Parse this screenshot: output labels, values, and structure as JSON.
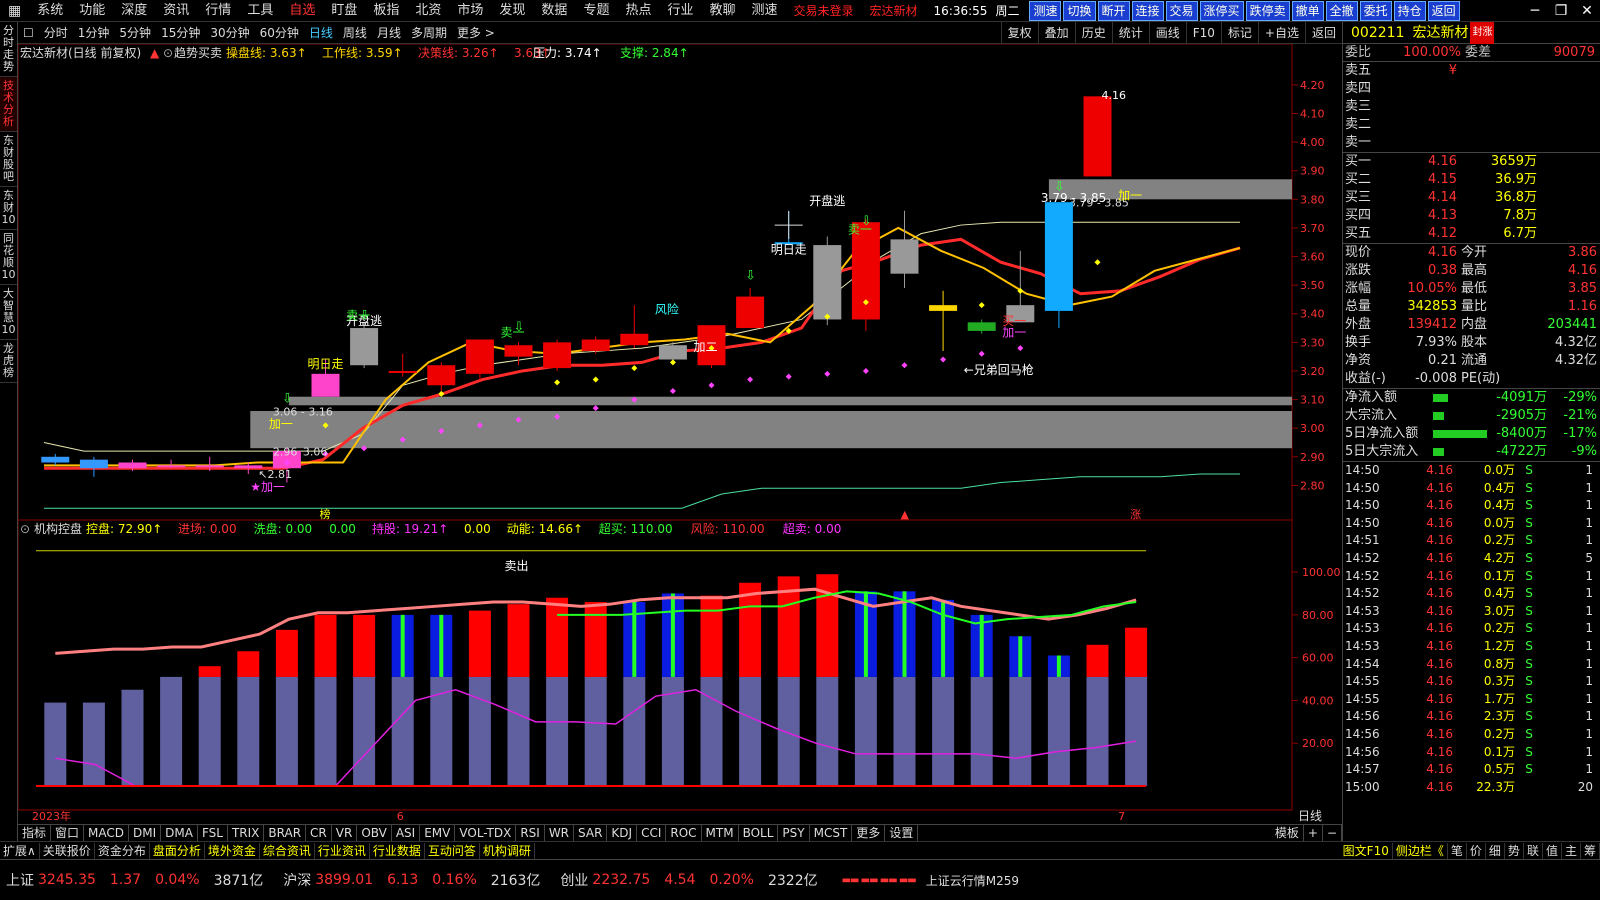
{
  "menubar": {
    "items": [
      "系统",
      "功能",
      "深度",
      "资讯",
      "行情",
      "工具",
      "自选",
      "盯盘",
      "板指",
      "北资",
      "市场",
      "发现",
      "数据",
      "专题",
      "热点",
      "行业",
      "教聊",
      "测速"
    ],
    "active_index": 6,
    "warning1": "交易未登录",
    "warning2": "宏达新材",
    "clock": "16:36:55",
    "weekday": "周二",
    "quick_buttons": [
      "测速",
      "切换",
      "断开",
      "连接",
      "交易",
      "涨停买",
      "跌停卖",
      "撤单",
      "全撤",
      "委托",
      "持仓",
      "返回"
    ],
    "window_controls": [
      "─",
      "❐",
      "✕"
    ]
  },
  "leftbar": {
    "tabs": [
      "分时走势",
      "技术分析",
      "东财股吧",
      "东财10",
      "同花顺10",
      "大智慧10",
      "龙虎榜"
    ],
    "active_index": 1
  },
  "periodbar": {
    "items": [
      "分时",
      "1分钟",
      "5分钟",
      "15分钟",
      "30分钟",
      "60分钟",
      "日线",
      "周线",
      "月线",
      "多周期",
      "更多 >"
    ],
    "active_index": 6,
    "tools": [
      "复权",
      "叠加",
      "历史",
      "统计",
      "画线",
      "F10",
      "标记",
      "+自选",
      "返回"
    ]
  },
  "main_chart": {
    "title": "宏达新材(日线 前复权)",
    "indicator_name": "趋势买卖",
    "labels": [
      {
        "name": "操盘线",
        "value": "3.63↑",
        "color": "#ffd700"
      },
      {
        "name": "工作线",
        "value": "3.59↑",
        "color": "#ffd700"
      },
      {
        "name": "决策线",
        "value": "3.26↑",
        "color": "#ff3333"
      },
      {
        "name": "",
        "value": "3.63↑",
        "color": "#ff3333"
      },
      {
        "name": "压力",
        "value": "3.74↑",
        "color": "#ffffff"
      },
      {
        "name": "支撑",
        "value": "2.84↑",
        "color": "#33ff33"
      }
    ],
    "annotations": [
      "明日走",
      "开盘逃",
      "明日走",
      "开盘逃",
      "卖一",
      "卖一",
      "风险",
      "加二",
      "加一",
      "加一",
      "←兄弟回马枪",
      "3.06 - 3.16",
      "2.96",
      "3.06",
      "2.81",
      "3.79 - 3.85",
      "4.16",
      "加一",
      "买一",
      "卖一"
    ],
    "bottom_markers": [
      "榜",
      "▲",
      "涨"
    ],
    "date_labels": [
      "2023年",
      "6",
      "7"
    ]
  },
  "sub_chart": {
    "name": "机构控盘",
    "labels": [
      {
        "name": "控盘",
        "value": "72.90↑",
        "color": "#ffff00"
      },
      {
        "name": "进场",
        "value": "0.00",
        "color": "#ff3333"
      },
      {
        "name": "洗盘",
        "value": "0.00",
        "color": "#33ff33"
      },
      {
        "name": "",
        "value": "0.00",
        "color": "#33ff33"
      },
      {
        "name": "持股",
        "value": "19.21↑",
        "color": "#ff33ff"
      },
      {
        "name": "",
        "value": "0.00",
        "color": "#ffff00"
      },
      {
        "name": "动能",
        "value": "14.66↑",
        "color": "#ffff00"
      },
      {
        "name": "超买",
        "value": "110.00",
        "color": "#33ff33"
      },
      {
        "name": "风险",
        "value": "110.00",
        "color": "#ff3333"
      },
      {
        "name": "超卖",
        "value": "0.00",
        "color": "#ff33ff"
      }
    ],
    "annotation": "卖出",
    "period_label": "日线"
  },
  "chart_data": [
    {
      "type": "candlestick",
      "title": "宏达新材(日线 前复权)",
      "ylim": [
        2.7,
        4.28
      ],
      "y_ticks": [
        4.2,
        4.1,
        4.0,
        3.9,
        3.8,
        3.7,
        3.6,
        3.5,
        3.4,
        3.3,
        3.2,
        3.1,
        3.0,
        2.9,
        2.8
      ],
      "candles": [
        {
          "o": 2.9,
          "c": 2.88,
          "h": 2.91,
          "l": 2.87
        },
        {
          "o": 2.89,
          "c": 2.86,
          "h": 2.9,
          "l": 2.83
        },
        {
          "o": 2.86,
          "c": 2.88,
          "h": 2.89,
          "l": 2.85
        },
        {
          "o": 2.87,
          "c": 2.87,
          "h": 2.89,
          "l": 2.86
        },
        {
          "o": 2.87,
          "c": 2.87,
          "h": 2.9,
          "l": 2.85
        },
        {
          "o": 2.86,
          "c": 2.87,
          "h": 2.88,
          "l": 2.84
        },
        {
          "o": 2.86,
          "c": 2.92,
          "h": 2.93,
          "l": 2.81
        },
        {
          "o": 3.11,
          "c": 3.19,
          "h": 3.24,
          "l": 3.11
        },
        {
          "o": 3.35,
          "c": 3.22,
          "h": 3.37,
          "l": 3.21
        },
        {
          "o": 3.2,
          "c": 3.2,
          "h": 3.26,
          "l": 3.18
        },
        {
          "o": 3.15,
          "c": 3.22,
          "h": 3.23,
          "l": 3.13
        },
        {
          "o": 3.19,
          "c": 3.31,
          "h": 3.31,
          "l": 3.17
        },
        {
          "o": 3.25,
          "c": 3.29,
          "h": 3.3,
          "l": 3.22
        },
        {
          "o": 3.21,
          "c": 3.3,
          "h": 3.31,
          "l": 3.2
        },
        {
          "o": 3.27,
          "c": 3.31,
          "h": 3.32,
          "l": 3.26
        },
        {
          "o": 3.29,
          "c": 3.33,
          "h": 3.43,
          "l": 3.28
        },
        {
          "o": 3.29,
          "c": 3.24,
          "h": 3.3,
          "l": 3.23
        },
        {
          "o": 3.22,
          "c": 3.36,
          "h": 3.36,
          "l": 3.21
        },
        {
          "o": 3.35,
          "c": 3.46,
          "h": 3.49,
          "l": 3.35
        },
        {
          "o": 3.65,
          "c": 3.65,
          "h": 3.76,
          "l": 3.64
        },
        {
          "o": 3.64,
          "c": 3.38,
          "h": 3.67,
          "l": 3.36
        },
        {
          "o": 3.38,
          "c": 3.72,
          "h": 3.73,
          "l": 3.34
        },
        {
          "o": 3.66,
          "c": 3.54,
          "h": 3.76,
          "l": 3.49
        },
        {
          "o": 3.43,
          "c": 3.41,
          "h": 3.48,
          "l": 3.27
        },
        {
          "o": 3.37,
          "c": 3.34,
          "h": 3.38,
          "l": 3.33
        },
        {
          "o": 3.43,
          "c": 3.37,
          "h": 3.62,
          "l": 3.37
        },
        {
          "o": 3.41,
          "c": 3.79,
          "h": 3.79,
          "l": 3.35
        },
        {
          "o": 3.88,
          "c": 4.16,
          "h": 4.16,
          "l": 3.88
        }
      ],
      "lines": {
        "decision_line": [
          2.86,
          2.86,
          2.86,
          2.86,
          2.86,
          2.86,
          2.86,
          2.89,
          3.0,
          3.08,
          3.12,
          3.17,
          3.2,
          3.22,
          3.22,
          3.23,
          3.27,
          3.28,
          3.3,
          3.35,
          3.55,
          3.59,
          3.64,
          3.66,
          3.58,
          3.54,
          3.47,
          3.48,
          3.53,
          3.59,
          3.63
        ],
        "work_line": [
          2.87,
          2.87,
          2.87,
          2.87,
          2.87,
          2.88,
          2.88,
          2.88,
          3.1,
          3.23,
          3.3,
          3.27,
          3.26,
          3.28,
          3.3,
          3.31,
          3.33,
          3.3,
          3.43,
          3.62,
          3.7,
          3.62,
          3.56,
          3.47,
          3.43,
          3.46,
          3.55,
          3.59,
          3.63
        ],
        "pressure_line": [
          2.95,
          2.92,
          2.92,
          2.92,
          2.92,
          2.92,
          2.92,
          2.92,
          2.98,
          3.15,
          3.19,
          3.22,
          3.24,
          3.26,
          3.27,
          3.28,
          3.3,
          3.32,
          3.35,
          3.38,
          3.49,
          3.6,
          3.68,
          3.71,
          3.72,
          3.72,
          3.72,
          3.72,
          3.72,
          3.72,
          3.72
        ],
        "support_line": [
          2.72,
          2.72,
          2.72,
          2.72,
          2.72,
          2.72,
          2.72,
          2.72,
          2.72,
          2.72,
          2.72,
          2.72,
          2.72,
          2.72,
          2.72,
          2.72,
          2.72,
          2.77,
          2.79,
          2.79,
          2.79,
          2.79,
          2.79,
          2.79,
          2.81,
          2.82,
          2.83,
          2.83,
          2.83,
          2.84,
          2.84
        ]
      },
      "zones": [
        {
          "from": 2.93,
          "to": 3.06,
          "label": "3.06 - 3.16"
        },
        {
          "from": 3.08,
          "to": 3.11,
          "label": ""
        },
        {
          "from": 3.8,
          "to": 3.87,
          "label": "3.79 - 3.85"
        }
      ]
    },
    {
      "type": "bar",
      "title": "机构控盘",
      "ylim": [
        0,
        115
      ],
      "y_ticks": [
        100,
        80,
        60,
        40,
        20
      ],
      "bars_base": [
        39,
        39,
        45,
        51,
        51,
        51,
        51,
        51,
        51,
        51,
        51,
        51,
        51,
        51,
        51,
        51,
        51,
        51,
        51,
        51,
        51,
        51,
        51,
        51,
        51,
        51,
        51,
        51,
        51
      ],
      "bars_top": [
        39,
        39,
        45,
        51,
        56,
        63,
        73,
        80,
        80,
        80,
        80,
        82,
        85,
        88,
        86,
        86,
        90,
        89,
        95,
        98,
        99,
        91,
        91,
        87,
        80,
        70,
        61,
        66,
        74
      ],
      "bars_color": [
        "base",
        "base",
        "base",
        "red",
        "red",
        "red",
        "red",
        "red",
        "red",
        "blue",
        "blue",
        "red",
        "red",
        "red",
        "red",
        "blue",
        "blue",
        "red",
        "red",
        "red",
        "red",
        "blue",
        "blue",
        "blue",
        "blue",
        "blue",
        "blue",
        "red",
        "red"
      ],
      "pink_line": [
        62,
        63,
        64,
        64,
        65,
        65,
        68,
        71,
        78,
        81,
        81,
        82,
        83,
        84,
        85,
        86,
        86,
        85,
        84,
        85,
        87,
        88,
        88,
        88,
        90,
        91,
        92,
        88,
        84,
        86,
        88,
        84,
        82,
        80,
        78,
        80,
        83,
        87
      ],
      "green_line": [
        80,
        80,
        80,
        81,
        82,
        82,
        84,
        84,
        88,
        91,
        90,
        86,
        80,
        76,
        78,
        79,
        80,
        84,
        86
      ],
      "magenta_line": [
        13,
        10,
        0,
        0,
        0,
        0,
        0,
        0,
        20,
        40,
        45,
        38,
        30,
        30,
        29,
        42,
        45,
        35,
        27,
        20,
        15,
        15,
        15,
        15,
        13,
        16,
        18,
        21
      ],
      "yellow_line": [
        110,
        110
      ]
    }
  ],
  "quote_panel": {
    "stock_code": "002211",
    "stock_name": "宏达新材",
    "badge": "封涨",
    "weibi_label": "委比",
    "weibi": "100.00%",
    "weicha_label": "委差",
    "weicha": "90079",
    "sells": [
      {
        "label": "卖五",
        "price": "¥",
        "vol": ""
      },
      {
        "label": "卖四",
        "price": "",
        "vol": ""
      },
      {
        "label": "卖三",
        "price": "",
        "vol": ""
      },
      {
        "label": "卖二",
        "price": "",
        "vol": ""
      },
      {
        "label": "卖一",
        "price": "",
        "vol": ""
      }
    ],
    "buys": [
      {
        "label": "买一",
        "price": "4.16",
        "vol": "3659万"
      },
      {
        "label": "买二",
        "price": "4.15",
        "vol": "36.9万"
      },
      {
        "label": "买三",
        "price": "4.14",
        "vol": "36.8万"
      },
      {
        "label": "买四",
        "price": "4.13",
        "vol": "7.8万"
      },
      {
        "label": "买五",
        "price": "4.12",
        "vol": "6.7万"
      }
    ],
    "stats": [
      {
        "k1": "现价",
        "v1": "4.16",
        "k2": "今开",
        "v2": "3.86",
        "c1": "#f33",
        "c2": "#f33"
      },
      {
        "k1": "涨跌",
        "v1": "0.38",
        "k2": "最高",
        "v2": "4.16",
        "c1": "#f33",
        "c2": "#f33"
      },
      {
        "k1": "涨幅",
        "v1": "10.05%",
        "k2": "最低",
        "v2": "3.85",
        "c1": "#f33",
        "c2": "#f33"
      },
      {
        "k1": "总量",
        "v1": "342853",
        "k2": "量比",
        "v2": "1.16",
        "c1": "#ff0",
        "c2": "#f33"
      },
      {
        "k1": "外盘",
        "v1": "139412",
        "k2": "内盘",
        "v2": "203441",
        "c1": "#f33",
        "c2": "#3f3"
      },
      {
        "k1": "换手",
        "v1": "7.93%",
        "k2": "股本",
        "v2": "4.32亿",
        "c1": "#ddd",
        "c2": "#ddd"
      },
      {
        "k1": "净资",
        "v1": "0.21",
        "k2": "流通",
        "v2": "4.32亿",
        "c1": "#ddd",
        "c2": "#ddd"
      },
      {
        "k1": "收益(-)",
        "v1": "-0.008",
        "k2": "PE(动)",
        "v2": "",
        "c1": "#ddd",
        "c2": "#ddd"
      }
    ],
    "flows": [
      {
        "label": "净流入额",
        "value": "-4091万",
        "pct": "-29%",
        "bar": 0.25
      },
      {
        "label": "大宗流入",
        "value": "-2905万",
        "pct": "-21%",
        "bar": 0.18
      },
      {
        "label": "5日净流入额",
        "value": "-8400万",
        "pct": "-17%",
        "bar": 0.9
      },
      {
        "label": "5日大宗流入",
        "value": "-4722万",
        "pct": "-9%",
        "bar": 0.18
      }
    ],
    "ticks": [
      {
        "t": "14:50",
        "p": "4.16",
        "v": "0.0万",
        "s": "S",
        "n": "1"
      },
      {
        "t": "14:50",
        "p": "4.16",
        "v": "0.4万",
        "s": "S",
        "n": "1"
      },
      {
        "t": "14:50",
        "p": "4.16",
        "v": "0.4万",
        "s": "S",
        "n": "1"
      },
      {
        "t": "14:50",
        "p": "4.16",
        "v": "0.0万",
        "s": "S",
        "n": "1"
      },
      {
        "t": "14:51",
        "p": "4.16",
        "v": "0.2万",
        "s": "S",
        "n": "1"
      },
      {
        "t": "14:52",
        "p": "4.16",
        "v": "4.2万",
        "s": "S",
        "n": "5"
      },
      {
        "t": "14:52",
        "p": "4.16",
        "v": "0.1万",
        "s": "S",
        "n": "1"
      },
      {
        "t": "14:52",
        "p": "4.16",
        "v": "0.4万",
        "s": "S",
        "n": "1"
      },
      {
        "t": "14:53",
        "p": "4.16",
        "v": "3.0万",
        "s": "S",
        "n": "1"
      },
      {
        "t": "14:53",
        "p": "4.16",
        "v": "0.2万",
        "s": "S",
        "n": "1"
      },
      {
        "t": "14:53",
        "p": "4.16",
        "v": "1.2万",
        "s": "S",
        "n": "1"
      },
      {
        "t": "14:54",
        "p": "4.16",
        "v": "0.8万",
        "s": "S",
        "n": "1"
      },
      {
        "t": "14:55",
        "p": "4.16",
        "v": "0.3万",
        "s": "S",
        "n": "1"
      },
      {
        "t": "14:55",
        "p": "4.16",
        "v": "1.7万",
        "s": "S",
        "n": "1"
      },
      {
        "t": "14:56",
        "p": "4.16",
        "v": "2.3万",
        "s": "S",
        "n": "1"
      },
      {
        "t": "14:56",
        "p": "4.16",
        "v": "0.2万",
        "s": "S",
        "n": "1"
      },
      {
        "t": "14:56",
        "p": "4.16",
        "v": "0.1万",
        "s": "S",
        "n": "1"
      },
      {
        "t": "14:57",
        "p": "4.16",
        "v": "0.5万",
        "s": "S",
        "n": "1"
      },
      {
        "t": "15:00",
        "p": "4.16",
        "v": "22.3万",
        "s": "",
        "n": "20"
      }
    ]
  },
  "bottom_tabs": [
    "指标",
    "窗口",
    "MACD",
    "DMI",
    "DMA",
    "FSL",
    "TRIX",
    "BRAR",
    "CR",
    "VR",
    "OBV",
    "ASI",
    "EMV",
    "VOL-TDX",
    "RSI",
    "WR",
    "SAR",
    "KDJ",
    "CCI",
    "ROC",
    "MTM",
    "BOLL",
    "PSY",
    "MCST",
    "更多",
    "设置"
  ],
  "bottom_tools": [
    "模板",
    "+",
    "−"
  ],
  "ext_tabs": [
    "扩展∧",
    "关联报价",
    "资金分布",
    "盘面分析",
    "境外资金",
    "综合资讯",
    "行业资讯",
    "行业数据",
    "互动问答",
    "机构调研"
  ],
  "ext_right": [
    "图文F10",
    "侧边栏《",
    "笔",
    "价",
    "细",
    "势",
    "联",
    "值",
    "主",
    "筹"
  ],
  "statusbar": {
    "indexes": [
      {
        "name": "上证",
        "value": "3245.35",
        "chg": "1.37",
        "pct": "0.04%",
        "amt": "3871亿"
      },
      {
        "name": "沪深",
        "value": "3899.01",
        "chg": "6.13",
        "pct": "0.16%",
        "amt": "2163亿"
      },
      {
        "name": "创业",
        "value": "2232.75",
        "chg": "4.54",
        "pct": "0.20%",
        "amt": "2322亿"
      }
    ],
    "ticker": "上证云行情M259"
  }
}
